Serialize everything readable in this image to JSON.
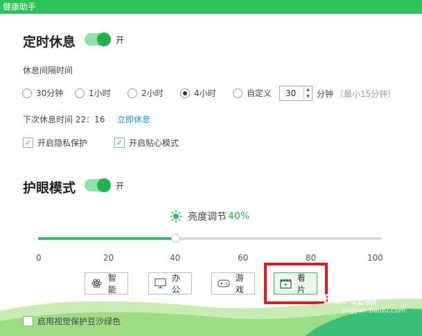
{
  "window": {
    "title": "健康助手"
  },
  "rest": {
    "title": "定时休息",
    "toggle_label": "开",
    "interval_label": "休息间隔时间",
    "options": [
      "30分钟",
      "1小时",
      "2小时",
      "4小时",
      "自定义"
    ],
    "selected": "4小时",
    "custom_value": "30",
    "custom_unit": "分钟",
    "custom_hint": "（最小15分钟）",
    "next_rest": "下次休息时间 22：16",
    "rest_now": "立即休息",
    "privacy_label": "开启隐私保护",
    "privacy_checked": true,
    "caring_label": "开启贴心模式",
    "caring_checked": true
  },
  "eye": {
    "title": "护眼模式",
    "toggle_label": "开",
    "brightness_label": "亮度调节",
    "brightness_value": "40%",
    "brightness_fraction": 0.4,
    "ticks": [
      "0",
      "20",
      "40",
      "60",
      "80",
      "100"
    ],
    "modes": {
      "smart": "智能",
      "office": "办公",
      "game": "游戏",
      "movie": "看片"
    },
    "active_mode": "看片",
    "green_bean_label": "启用视觉保护豆沙绿色",
    "green_bean_checked": false
  },
  "watermark": {
    "main": "Bai 经验",
    "sub": "jingyan.baidu.com"
  },
  "colors": {
    "accent": "#2fc25b",
    "highlight": "#e4151b",
    "link": "#1a95d6"
  }
}
